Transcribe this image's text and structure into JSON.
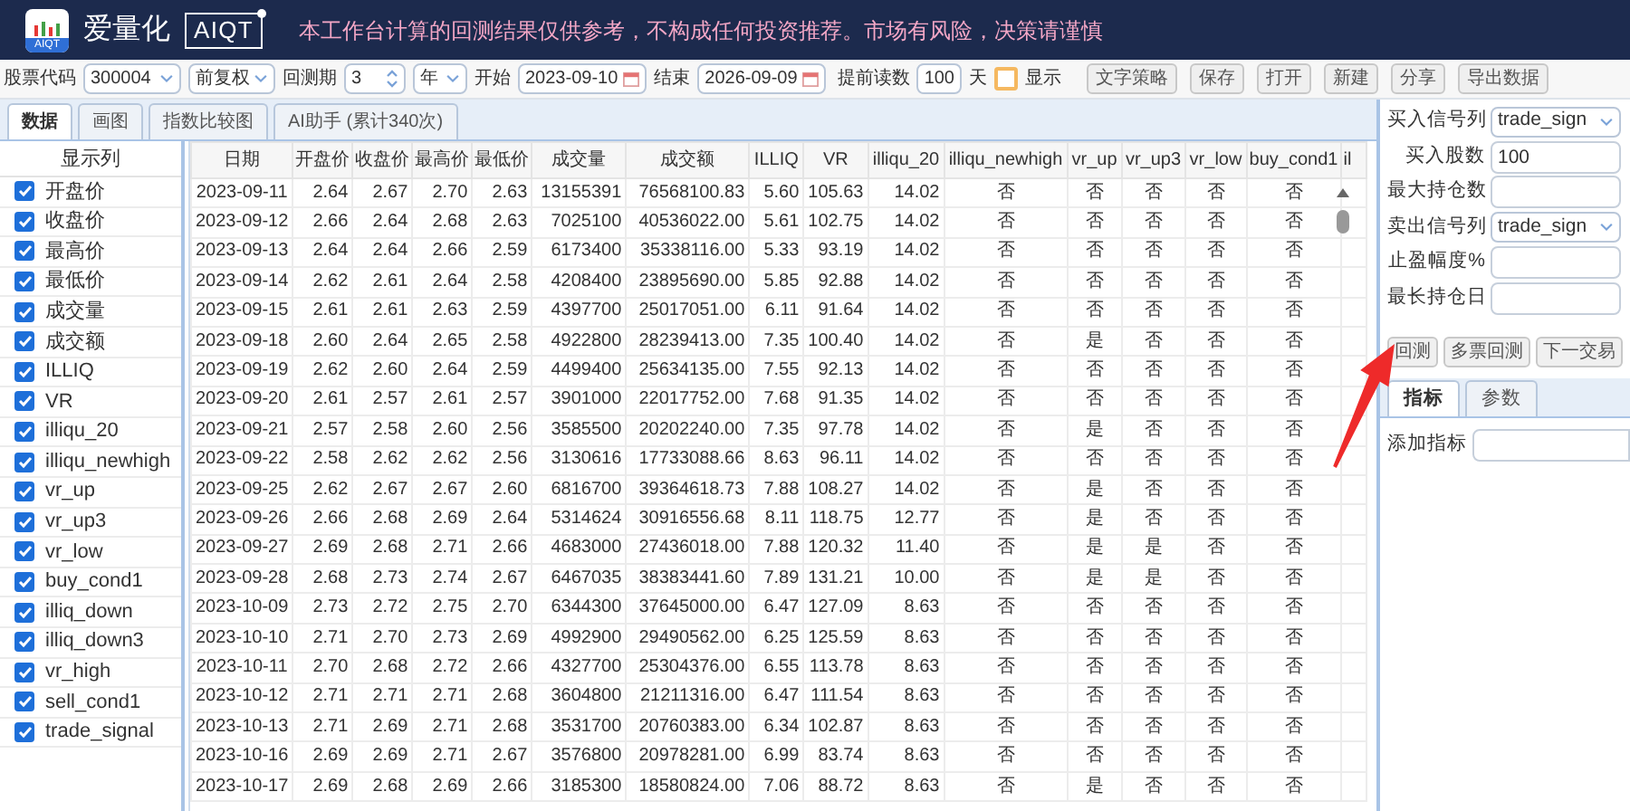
{
  "title_bar": {
    "logo_text": "AIQT",
    "app_name": "爱量化",
    "brand_badge": "AIQT",
    "notice": "本工作台计算的回测结果仅供参考，不构成任何投资推荐。市场有风险，决策请谨慎"
  },
  "toolbar": {
    "stock_code": {
      "label": "股票代码",
      "value": "300004"
    },
    "adjust": {
      "value": "前复权"
    },
    "period": {
      "label": "回测期",
      "value": "3"
    },
    "period_unit": {
      "value": "年"
    },
    "start": {
      "label": "开始",
      "value": "2023-09-10"
    },
    "end": {
      "label": "结束",
      "value": "2026-09-09"
    },
    "preload": {
      "label": "提前读数",
      "value": "100",
      "unit": "天"
    },
    "show": {
      "label": "显示",
      "checked": false
    },
    "buttons": [
      "文字策略",
      "保存",
      "打开",
      "新建",
      "分享",
      "导出数据"
    ]
  },
  "tabs": [
    {
      "label": "数据",
      "selected": true
    },
    {
      "label": "画图",
      "selected": false
    },
    {
      "label": "指数比较图",
      "selected": false
    },
    {
      "label": "AI助手 (累计340次)",
      "selected": false
    }
  ],
  "column_panel": {
    "title": "显示列",
    "items": [
      {
        "label": "开盘价",
        "checked": true
      },
      {
        "label": "收盘价",
        "checked": true
      },
      {
        "label": "最高价",
        "checked": true
      },
      {
        "label": "最低价",
        "checked": true
      },
      {
        "label": "成交量",
        "checked": true
      },
      {
        "label": "成交额",
        "checked": true
      },
      {
        "label": "ILLIQ",
        "checked": true
      },
      {
        "label": "VR",
        "checked": true
      },
      {
        "label": "illiqu_20",
        "checked": true
      },
      {
        "label": "illiqu_newhigh",
        "checked": true
      },
      {
        "label": "vr_up",
        "checked": true
      },
      {
        "label": "vr_up3",
        "checked": true
      },
      {
        "label": "vr_low",
        "checked": true
      },
      {
        "label": "buy_cond1",
        "checked": true
      },
      {
        "label": "illiq_down",
        "checked": true
      },
      {
        "label": "illiq_down3",
        "checked": true
      },
      {
        "label": "vr_high",
        "checked": true
      },
      {
        "label": "sell_cond1",
        "checked": true
      },
      {
        "label": "trade_signal",
        "checked": true
      }
    ]
  },
  "table": {
    "columns": [
      "日期",
      "开盘价",
      "收盘价",
      "最高价",
      "最低价",
      "成交量",
      "成交额",
      "ILLIQ",
      "VR",
      "illiqu_20",
      "illiqu_newhigh",
      "vr_up",
      "vr_up3",
      "vr_low",
      "buy_cond1",
      "il"
    ],
    "rows": [
      [
        "2023-09-11",
        "2.64",
        "2.67",
        "2.70",
        "2.63",
        "13155391",
        "76568100.83",
        "5.60",
        "105.63",
        "14.02",
        "否",
        "否",
        "否",
        "否",
        "否"
      ],
      [
        "2023-09-12",
        "2.66",
        "2.64",
        "2.68",
        "2.63",
        "7025100",
        "40536022.00",
        "5.61",
        "102.75",
        "14.02",
        "否",
        "否",
        "否",
        "否",
        "否"
      ],
      [
        "2023-09-13",
        "2.64",
        "2.64",
        "2.66",
        "2.59",
        "6173400",
        "35338116.00",
        "5.33",
        "93.19",
        "14.02",
        "否",
        "否",
        "否",
        "否",
        "否"
      ],
      [
        "2023-09-14",
        "2.62",
        "2.61",
        "2.64",
        "2.58",
        "4208400",
        "23895690.00",
        "5.85",
        "92.88",
        "14.02",
        "否",
        "否",
        "否",
        "否",
        "否"
      ],
      [
        "2023-09-15",
        "2.61",
        "2.61",
        "2.63",
        "2.59",
        "4397700",
        "25017051.00",
        "6.11",
        "91.64",
        "14.02",
        "否",
        "否",
        "否",
        "否",
        "否"
      ],
      [
        "2023-09-18",
        "2.60",
        "2.64",
        "2.65",
        "2.58",
        "4922800",
        "28239413.00",
        "7.35",
        "100.40",
        "14.02",
        "否",
        "是",
        "否",
        "否",
        "否"
      ],
      [
        "2023-09-19",
        "2.62",
        "2.60",
        "2.64",
        "2.59",
        "4499400",
        "25634135.00",
        "7.55",
        "92.13",
        "14.02",
        "否",
        "否",
        "否",
        "否",
        "否"
      ],
      [
        "2023-09-20",
        "2.61",
        "2.57",
        "2.61",
        "2.57",
        "3901000",
        "22017752.00",
        "7.68",
        "91.35",
        "14.02",
        "否",
        "否",
        "否",
        "否",
        "否"
      ],
      [
        "2023-09-21",
        "2.57",
        "2.58",
        "2.60",
        "2.56",
        "3585500",
        "20202240.00",
        "7.35",
        "97.78",
        "14.02",
        "否",
        "是",
        "否",
        "否",
        "否"
      ],
      [
        "2023-09-22",
        "2.58",
        "2.62",
        "2.62",
        "2.56",
        "3130616",
        "17733088.66",
        "8.63",
        "96.11",
        "14.02",
        "否",
        "否",
        "否",
        "否",
        "否"
      ],
      [
        "2023-09-25",
        "2.62",
        "2.67",
        "2.67",
        "2.60",
        "6816700",
        "39364618.73",
        "7.88",
        "108.27",
        "14.02",
        "否",
        "是",
        "否",
        "否",
        "否"
      ],
      [
        "2023-09-26",
        "2.66",
        "2.68",
        "2.69",
        "2.64",
        "5314624",
        "30916556.68",
        "8.11",
        "118.75",
        "12.77",
        "否",
        "是",
        "否",
        "否",
        "否"
      ],
      [
        "2023-09-27",
        "2.69",
        "2.68",
        "2.71",
        "2.66",
        "4683000",
        "27436018.00",
        "7.88",
        "120.32",
        "11.40",
        "否",
        "是",
        "是",
        "否",
        "否"
      ],
      [
        "2023-09-28",
        "2.68",
        "2.73",
        "2.74",
        "2.67",
        "6467035",
        "38383441.60",
        "7.89",
        "131.21",
        "10.00",
        "否",
        "是",
        "是",
        "否",
        "否"
      ],
      [
        "2023-10-09",
        "2.73",
        "2.72",
        "2.75",
        "2.70",
        "6344300",
        "37645000.00",
        "6.47",
        "127.09",
        "8.63",
        "否",
        "否",
        "否",
        "否",
        "否"
      ],
      [
        "2023-10-10",
        "2.71",
        "2.70",
        "2.73",
        "2.69",
        "4992900",
        "29490562.00",
        "6.25",
        "125.59",
        "8.63",
        "否",
        "否",
        "否",
        "否",
        "否"
      ],
      [
        "2023-10-11",
        "2.70",
        "2.68",
        "2.72",
        "2.66",
        "4327700",
        "25304376.00",
        "6.55",
        "113.78",
        "8.63",
        "否",
        "否",
        "否",
        "否",
        "否"
      ],
      [
        "2023-10-12",
        "2.71",
        "2.71",
        "2.71",
        "2.68",
        "3604800",
        "21211316.00",
        "6.47",
        "111.54",
        "8.63",
        "否",
        "否",
        "否",
        "否",
        "否"
      ],
      [
        "2023-10-13",
        "2.71",
        "2.69",
        "2.71",
        "2.68",
        "3531700",
        "20760383.00",
        "6.34",
        "102.87",
        "8.63",
        "否",
        "否",
        "否",
        "否",
        "否"
      ],
      [
        "2023-10-16",
        "2.69",
        "2.69",
        "2.71",
        "2.67",
        "3576800",
        "20978281.00",
        "6.99",
        "83.74",
        "8.63",
        "否",
        "否",
        "否",
        "否",
        "否"
      ],
      [
        "2023-10-17",
        "2.69",
        "2.68",
        "2.69",
        "2.66",
        "3185300",
        "18580824.00",
        "7.06",
        "88.72",
        "8.63",
        "否",
        "是",
        "否",
        "否",
        "否"
      ]
    ]
  },
  "strategy_panel": {
    "fields": [
      {
        "kind": "select",
        "label": "买入信号列",
        "value": "trade_sign"
      },
      {
        "kind": "input",
        "label": "买入股数",
        "value": "100"
      },
      {
        "kind": "input",
        "label": "最大持仓数"
      },
      {
        "kind": "select",
        "label": "卖出信号列",
        "value": "trade_sign"
      },
      {
        "kind": "input",
        "label": "止盈幅度%"
      },
      {
        "kind": "input",
        "label": "最长持仓日"
      }
    ],
    "buttons": [
      "回测",
      "多票回测",
      "下一交易"
    ],
    "tabs": [
      {
        "label": "指标",
        "selected": true
      },
      {
        "label": "参数",
        "selected": false
      }
    ],
    "add_indicator": {
      "label": "添加指标"
    }
  }
}
